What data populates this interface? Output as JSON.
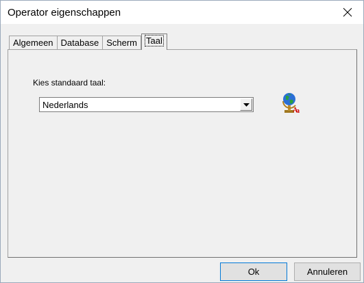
{
  "window": {
    "title": "Operator eigenschappen"
  },
  "tabs": [
    {
      "label": "Algemeen",
      "active": false
    },
    {
      "label": "Database",
      "active": false
    },
    {
      "label": "Scherm",
      "active": false
    },
    {
      "label": "Taal",
      "active": true
    }
  ],
  "language": {
    "label": "Kies standaard taal:",
    "selected": "Nederlands"
  },
  "icons": {
    "close": "close-icon",
    "dropdown": "chevron-down-icon",
    "globe": "globe-icon"
  },
  "buttons": {
    "ok": "Ok",
    "cancel": "Annuleren"
  }
}
